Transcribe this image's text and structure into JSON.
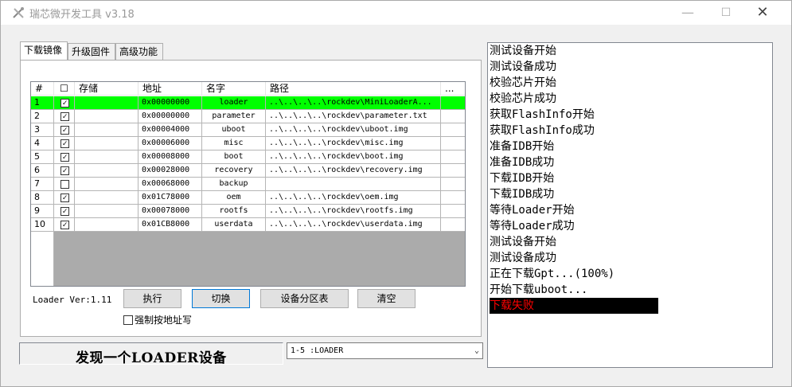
{
  "window": {
    "title": "瑞芯微开发工具 v3.18",
    "minimize_glyph": "—",
    "maximize_glyph": "☐",
    "close_glyph": "✕"
  },
  "tabs": [
    "下载镜像",
    "升级固件",
    "高级功能"
  ],
  "grid": {
    "headers": [
      "#",
      "☐",
      "存储",
      "地址",
      "名字",
      "路径",
      "..."
    ],
    "rows": [
      {
        "num": "1",
        "checked": true,
        "storage": "",
        "address": "0x00000000",
        "name": "loader",
        "path": "..\\..\\..\\..\\rockdev\\MiniLoaderA...",
        "selected": true
      },
      {
        "num": "2",
        "checked": true,
        "storage": "",
        "address": "0x00000000",
        "name": "parameter",
        "path": "..\\..\\..\\..\\rockdev\\parameter.txt",
        "selected": false
      },
      {
        "num": "3",
        "checked": true,
        "storage": "",
        "address": "0x00004000",
        "name": "uboot",
        "path": "..\\..\\..\\..\\rockdev\\uboot.img",
        "selected": false
      },
      {
        "num": "4",
        "checked": true,
        "storage": "",
        "address": "0x00006000",
        "name": "misc",
        "path": "..\\..\\..\\..\\rockdev\\misc.img",
        "selected": false
      },
      {
        "num": "5",
        "checked": true,
        "storage": "",
        "address": "0x00008000",
        "name": "boot",
        "path": "..\\..\\..\\..\\rockdev\\boot.img",
        "selected": false
      },
      {
        "num": "6",
        "checked": true,
        "storage": "",
        "address": "0x00028000",
        "name": "recovery",
        "path": "..\\..\\..\\..\\rockdev\\recovery.img",
        "selected": false
      },
      {
        "num": "7",
        "checked": false,
        "storage": "",
        "address": "0x00068000",
        "name": "backup",
        "path": "",
        "selected": false
      },
      {
        "num": "8",
        "checked": true,
        "storage": "",
        "address": "0x01C78000",
        "name": "oem",
        "path": "..\\..\\..\\..\\rockdev\\oem.img",
        "selected": false
      },
      {
        "num": "9",
        "checked": true,
        "storage": "",
        "address": "0x00078000",
        "name": "rootfs",
        "path": "..\\..\\..\\..\\rockdev\\rootfs.img",
        "selected": false
      },
      {
        "num": "10",
        "checked": true,
        "storage": "",
        "address": "0x01CB8000",
        "name": "userdata",
        "path": "..\\..\\..\\..\\rockdev\\userdata.img",
        "selected": false
      }
    ]
  },
  "controls": {
    "loader_version": "Loader Ver:1.11",
    "run_label": "执行",
    "switch_label": "切换",
    "partition_label": "设备分区表",
    "clear_label": "清空",
    "force_address_label": "强制按地址写"
  },
  "status": {
    "message": "发现一个LOADER设备",
    "device_selected": "1-5 :LOADER"
  },
  "log": {
    "lines": [
      "测试设备开始",
      "测试设备成功",
      "校验芯片开始",
      "校验芯片成功",
      "获取FlashInfo开始",
      "获取FlashInfo成功",
      "准备IDB开始",
      "准备IDB成功",
      "下载IDB开始",
      "下载IDB成功",
      "等待Loader开始",
      "等待Loader成功",
      "测试设备开始",
      "测试设备成功",
      "正在下载Gpt...(100%)",
      "开始下载uboot..."
    ],
    "error_line": "下载失败"
  },
  "colors": {
    "selected_row": "#00ff00",
    "error_bg": "#000000",
    "error_text": "#ff0000",
    "focus_border": "#0078d7"
  }
}
